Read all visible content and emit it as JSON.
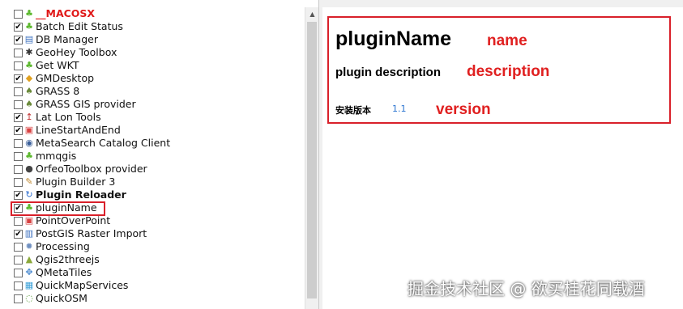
{
  "plugins": [
    {
      "label": "__MACOSX",
      "checked": false,
      "icon": "puzzle-icon",
      "style": "red"
    },
    {
      "label": "Batch Edit Status",
      "checked": true,
      "icon": "puzzle-icon"
    },
    {
      "label": "DB Manager",
      "checked": true,
      "icon": "database-icon"
    },
    {
      "label": "GeoHey Toolbox",
      "checked": false,
      "icon": "gear-icon"
    },
    {
      "label": "Get WKT",
      "checked": false,
      "icon": "puzzle-icon"
    },
    {
      "label": "GMDesktop",
      "checked": true,
      "icon": "globe-icon"
    },
    {
      "label": "GRASS 8",
      "checked": false,
      "icon": "grass-icon"
    },
    {
      "label": "GRASS GIS provider",
      "checked": false,
      "icon": "grass-icon"
    },
    {
      "label": "Lat Lon Tools",
      "checked": true,
      "icon": "latlon-icon"
    },
    {
      "label": "LineStartAndEnd",
      "checked": true,
      "icon": "line-icon"
    },
    {
      "label": "MetaSearch Catalog Client",
      "checked": false,
      "icon": "search-icon"
    },
    {
      "label": "mmqgis",
      "checked": false,
      "icon": "puzzle-icon"
    },
    {
      "label": "OrfeoToolbox provider",
      "checked": false,
      "icon": "toolbox-icon"
    },
    {
      "label": "Plugin Builder 3",
      "checked": false,
      "icon": "wand-icon"
    },
    {
      "label": "Plugin Reloader",
      "checked": true,
      "icon": "reload-icon",
      "style": "bold"
    },
    {
      "label": "pluginName",
      "checked": true,
      "icon": "puzzle-icon"
    },
    {
      "label": "PointOverPoint",
      "checked": false,
      "icon": "point-icon"
    },
    {
      "label": "PostGIS Raster Import",
      "checked": true,
      "icon": "raster-icon"
    },
    {
      "label": "Processing",
      "checked": false,
      "icon": "processing-icon"
    },
    {
      "label": "Qgis2threejs",
      "checked": false,
      "icon": "triangle-icon"
    },
    {
      "label": "QMetaTiles",
      "checked": false,
      "icon": "tiles-icon"
    },
    {
      "label": "QuickMapServices",
      "checked": false,
      "icon": "map-icon"
    },
    {
      "label": "QuickOSM",
      "checked": false,
      "icon": "osm-icon"
    }
  ],
  "icon_glyphs": {
    "puzzle-icon": "♣",
    "database-icon": "▤",
    "gear-icon": "✱",
    "globe-icon": "◆",
    "grass-icon": "♠",
    "latlon-icon": "↥",
    "line-icon": "▣",
    "search-icon": "◉",
    "toolbox-icon": "●",
    "wand-icon": "✎",
    "reload-icon": "↻",
    "point-icon": "▣",
    "raster-icon": "▥",
    "processing-icon": "✹",
    "triangle-icon": "▲",
    "tiles-icon": "✥",
    "map-icon": "▦",
    "osm-icon": "◌"
  },
  "icon_colors": {
    "puzzle-icon": "#5cb82e",
    "database-icon": "#3a6fbf",
    "gear-icon": "#333333",
    "globe-icon": "#e0a020",
    "grass-icon": "#6a8a3a",
    "latlon-icon": "#c03030",
    "line-icon": "#d84040",
    "search-icon": "#3a5f9a",
    "toolbox-icon": "#444444",
    "wand-icon": "#c08a30",
    "reload-icon": "#2f6fd0",
    "point-icon": "#d84040",
    "raster-icon": "#3a6fbf",
    "processing-icon": "#6f8fc0",
    "triangle-icon": "#8aa83a",
    "tiles-icon": "#4a8ad0",
    "map-icon": "#3aa0d8",
    "osm-icon": "#5a9a3a"
  },
  "detail": {
    "title": "pluginName",
    "description": "plugin description",
    "version_label": "安装版本",
    "version_value": "1.1"
  },
  "annotations": {
    "name": "name",
    "description": "description",
    "version": "version"
  },
  "watermark": "掘金技术社区 @ 欲买桂花同载酒",
  "colors": {
    "highlight_border": "#d9202a",
    "annotation_text": "#e02020",
    "version_value": "#2a74d0"
  }
}
